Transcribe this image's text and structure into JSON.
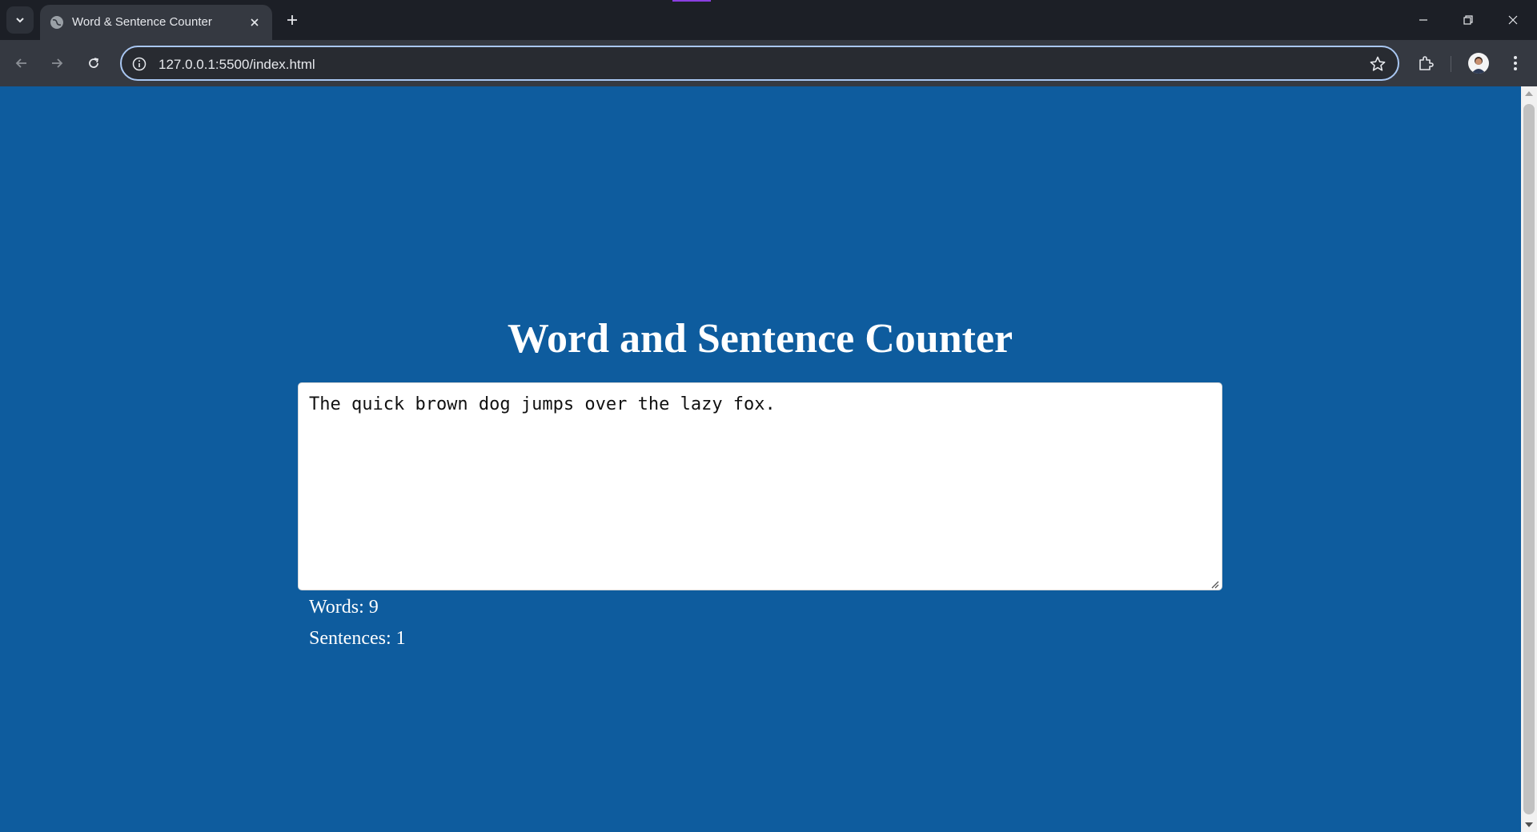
{
  "browser": {
    "tab_title": "Word & Sentence Counter",
    "url": "127.0.0.1:5500/index.html",
    "accent_color": "#8a3ee0",
    "icons": [
      "tab-search-icon",
      "globe-icon",
      "close-icon",
      "plus-icon",
      "minimize-icon",
      "restore-icon",
      "close-window-icon",
      "back-icon",
      "forward-icon",
      "reload-icon",
      "info-icon",
      "star-icon",
      "extensions-icon",
      "avatar",
      "kebab-menu-icon"
    ]
  },
  "page": {
    "background_color": "#0e5c9e",
    "title": "Word and Sentence Counter",
    "textarea_value": "The quick brown dog jumps over the lazy fox.",
    "words_text": "Words: 9",
    "sentences_text": "Sentences: 1"
  }
}
